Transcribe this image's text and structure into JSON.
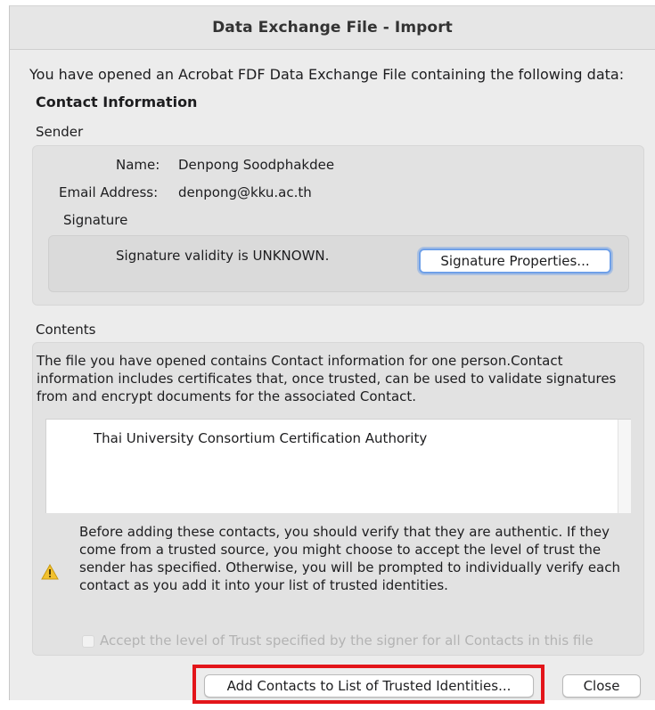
{
  "dialog": {
    "title": "Data Exchange File - Import",
    "intro": "You have opened an Acrobat FDF Data Exchange File containing the following data:",
    "section_heading": "Contact Information"
  },
  "sender": {
    "group_label": "Sender",
    "name_label": "Name:",
    "name_value": "Denpong Soodphakdee",
    "email_label": "Email Address:",
    "email_value": "denpong@kku.ac.th",
    "signature_label": "Signature",
    "signature_status": "Signature validity is UNKNOWN.",
    "signature_button": "Signature Properties..."
  },
  "contents": {
    "group_label": "Contents",
    "description": "The file you have opened contains Contact information for one person.Contact information includes certificates that, once trusted, can be used to validate signatures from and encrypt documents for the associated Contact.",
    "list_items": [
      "Thai University Consortium Certification Authority"
    ],
    "warning": "Before adding these contacts, you should verify that they are authentic. If they come from a trusted source, you might choose to accept the level of trust the sender has specified. Otherwise, you will be prompted to individually verify each contact as you add it into your list of trusted identities.",
    "accept_trust_label": "Accept the level of Trust specified by the signer for all Contacts in this file",
    "accept_trust_checked": false
  },
  "buttons": {
    "add_contacts": "Add Contacts to List of Trusted Identities...",
    "close": "Close"
  },
  "colors": {
    "highlight": "#e3151a",
    "focus_ring": "#6fa0e8",
    "warning_icon": "#f2c12e"
  }
}
